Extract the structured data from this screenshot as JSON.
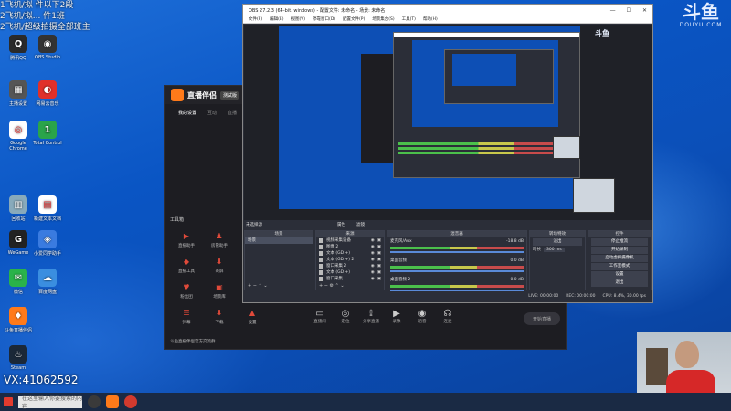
{
  "overlay": {
    "line1": "1飞机/拟 件以下2段",
    "line2": "2飞机/拟... 件1班",
    "line3": "2飞机/超级拍摄全部班主",
    "line4": "VX:41062592"
  },
  "brand": {
    "main": "斗鱼",
    "sub": "DOUYU.COM"
  },
  "desktop_icons": [
    {
      "label": "腾讯QQ",
      "color": "#2a2a2a",
      "glyph": "Q"
    },
    {
      "label": "OBS Studio",
      "color": "#333",
      "glyph": "◉"
    },
    {
      "label": "主播设置",
      "color": "#555",
      "glyph": "▦"
    },
    {
      "label": "网易云音乐",
      "color": "#e0302a",
      "glyph": "◐"
    },
    {
      "label": "Google Chrome",
      "color": "#fff",
      "glyph": "◎"
    },
    {
      "label": "Total Control",
      "color": "#2aa44a",
      "glyph": "1"
    },
    {
      "label": "回收站",
      "color": "#8ab",
      "glyph": "▥"
    },
    {
      "label": "新建文本文档",
      "color": "#fff",
      "glyph": "▤"
    },
    {
      "label": "WeGame",
      "color": "#222",
      "glyph": "G"
    },
    {
      "label": "小爱同学助手",
      "color": "#3a7be0",
      "glyph": "◈"
    },
    {
      "label": "微信",
      "color": "#2ab34a",
      "glyph": "✉"
    },
    {
      "label": "百度网盘",
      "color": "#3a8ee0",
      "glyph": "☁"
    },
    {
      "label": "斗鱼直播伴侣",
      "color": "#ff7a1a",
      "glyph": "♦"
    },
    {
      "label": "Steam",
      "color": "#1b2838",
      "glyph": "♨"
    }
  ],
  "companion": {
    "title": "直播伴侣",
    "version": "测试版",
    "tabs": [
      "我的设置",
      "互动",
      "直播"
    ],
    "tool_header": "工具箱",
    "tools": [
      {
        "label": "直播助手",
        "glyph": "▶"
      },
      {
        "label": "房管助手",
        "glyph": "♟"
      },
      {
        "label": "主播",
        "glyph": "★"
      },
      {
        "label": "直播工具",
        "glyph": "◆"
      },
      {
        "label": "录屏",
        "glyph": "⬇"
      },
      {
        "label": "",
        "glyph": ""
      },
      {
        "label": "粉丝团",
        "glyph": "♥"
      },
      {
        "label": "场景库",
        "glyph": "▣"
      },
      {
        "label": "",
        "glyph": ""
      },
      {
        "label": "弹幕",
        "glyph": "☰"
      },
      {
        "label": "下载",
        "glyph": "⬇"
      },
      {
        "label": "设置",
        "glyph": "▲"
      }
    ],
    "bottom": [
      {
        "label": "直播间",
        "glyph": "▭"
      },
      {
        "label": "定位",
        "glyph": "◎"
      },
      {
        "label": "分享直播",
        "glyph": "⇪"
      },
      {
        "label": "录像",
        "glyph": "▶"
      },
      {
        "label": "语音",
        "glyph": "◉"
      },
      {
        "label": "连麦",
        "glyph": "☊"
      }
    ],
    "start_btn": "开始直播",
    "footer_text": "斗鱼直播伴侣官方交流群"
  },
  "obs": {
    "title": "OBS 27.2.3 (64-bit, windows) - 配置文件: 未命名 - 场景: 未命名",
    "menu": [
      "文件(F)",
      "编辑(E)",
      "视图(V)",
      "停靠窗口(D)",
      "配置文件(P)",
      "场景集合(S)",
      "工具(T)",
      "帮助(H)"
    ],
    "scene_label": "未选择源",
    "props_btn": "属性",
    "filters_btn": "滤镜",
    "panels": {
      "scenes": "场景",
      "sources": "来源",
      "mixer": "混音器",
      "transitions": "转场特效",
      "controls": "控件"
    },
    "scenes": [
      "场景"
    ],
    "sources": [
      "视频采集设备",
      "图像 2",
      "文本 (GDI+)",
      "文本 (GDI+) 2",
      "窗口采集 2",
      "文本 (GDI+)",
      "窗口采集"
    ],
    "mixer": [
      {
        "name": "麦克风/Aux",
        "db": "-18.8 dB"
      },
      {
        "name": "桌面音频",
        "db": "0.0 dB"
      },
      {
        "name": "桌面音频 2",
        "db": "0.0 dB"
      }
    ],
    "transition": {
      "type": "淡出",
      "duration_label": "时长",
      "duration": "300 ms"
    },
    "controls": [
      "停止推流",
      "开始录制",
      "启动虚拟摄像机",
      "工作室模式",
      "设置",
      "退出"
    ],
    "status": {
      "live": "LIVE: 00:00:00",
      "rec": "REC: 00:00:00",
      "cpu": "CPU: 8.4%, 30.00 fps"
    }
  },
  "taskbar": {
    "search": "在这里输入你要搜索的内容"
  }
}
